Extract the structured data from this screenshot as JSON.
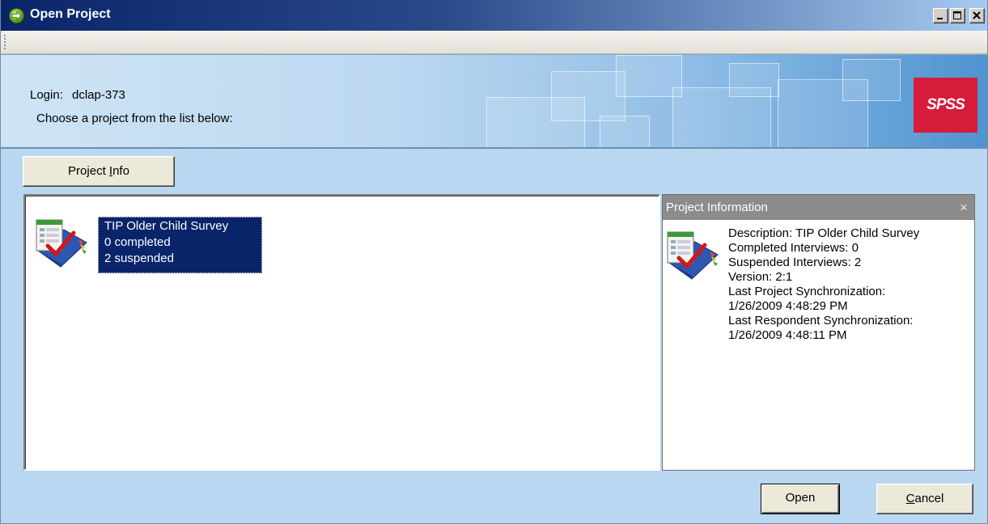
{
  "window": {
    "title": "Open Project",
    "icon": "green-arrow-circle-icon",
    "controls": [
      "minimize",
      "maximize",
      "close"
    ]
  },
  "banner": {
    "login_label": "Login:",
    "login_value": "dclap-373",
    "instruction": "Choose a project from the list below:",
    "logo_text": "SPSS"
  },
  "buttons": {
    "project_info_pre": "Project ",
    "project_info_key": "I",
    "project_info_post": "nfo",
    "open": "Open",
    "cancel_key": "C",
    "cancel_post": "ancel"
  },
  "project_list": [
    {
      "name": "TIP Older Child Survey",
      "completed": "0 completed",
      "suspended": "2 suspended",
      "selected": true
    }
  ],
  "project_info": {
    "header": "Project Information",
    "close_glyph": "×",
    "lines": [
      "Description:  TIP Older Child Survey",
      "Completed Interviews:  0",
      "Suspended Interviews:  2",
      "Version:  2:1",
      "Last Project Synchronization:",
      "1/26/2009 4:48:29 PM",
      "Last Respondent Synchronization:",
      "1/26/2009 4:48:11 PM"
    ]
  },
  "colors": {
    "title_gradient_start": "#0a246a",
    "selection": "#0a246a",
    "dialog_bg": "#b9d7f0",
    "logo_red": "#d71b3b"
  }
}
